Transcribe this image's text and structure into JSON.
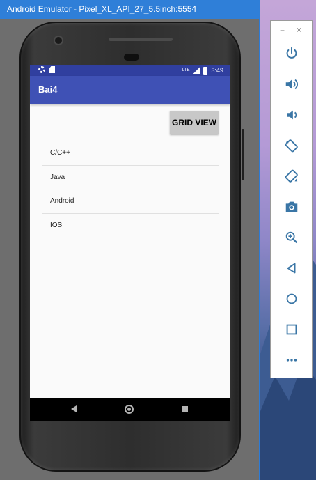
{
  "emulator": {
    "title": "Android Emulator - Pixel_XL_API_27_5.5inch:5554"
  },
  "status_bar": {
    "time": "3:49",
    "network_label": "LTE"
  },
  "app": {
    "title": "Bai4",
    "grid_view_button": "GRID VIEW",
    "items": [
      "C/C++",
      "Java",
      "Android",
      "IOS"
    ]
  },
  "toolbar": {
    "minimize": "−",
    "close": "×",
    "buttons": [
      "power-icon",
      "volume-up-icon",
      "volume-down-icon",
      "rotate-left-icon",
      "rotate-right-icon",
      "screenshot-icon",
      "zoom-icon",
      "back-icon",
      "home-icon",
      "overview-icon",
      "more-icon"
    ]
  },
  "colors": {
    "app_bar": "#3f51b5",
    "status_bar": "#303f9f",
    "toolbar_icon": "#3a76a6",
    "title_bar": "#2f7fd8"
  }
}
